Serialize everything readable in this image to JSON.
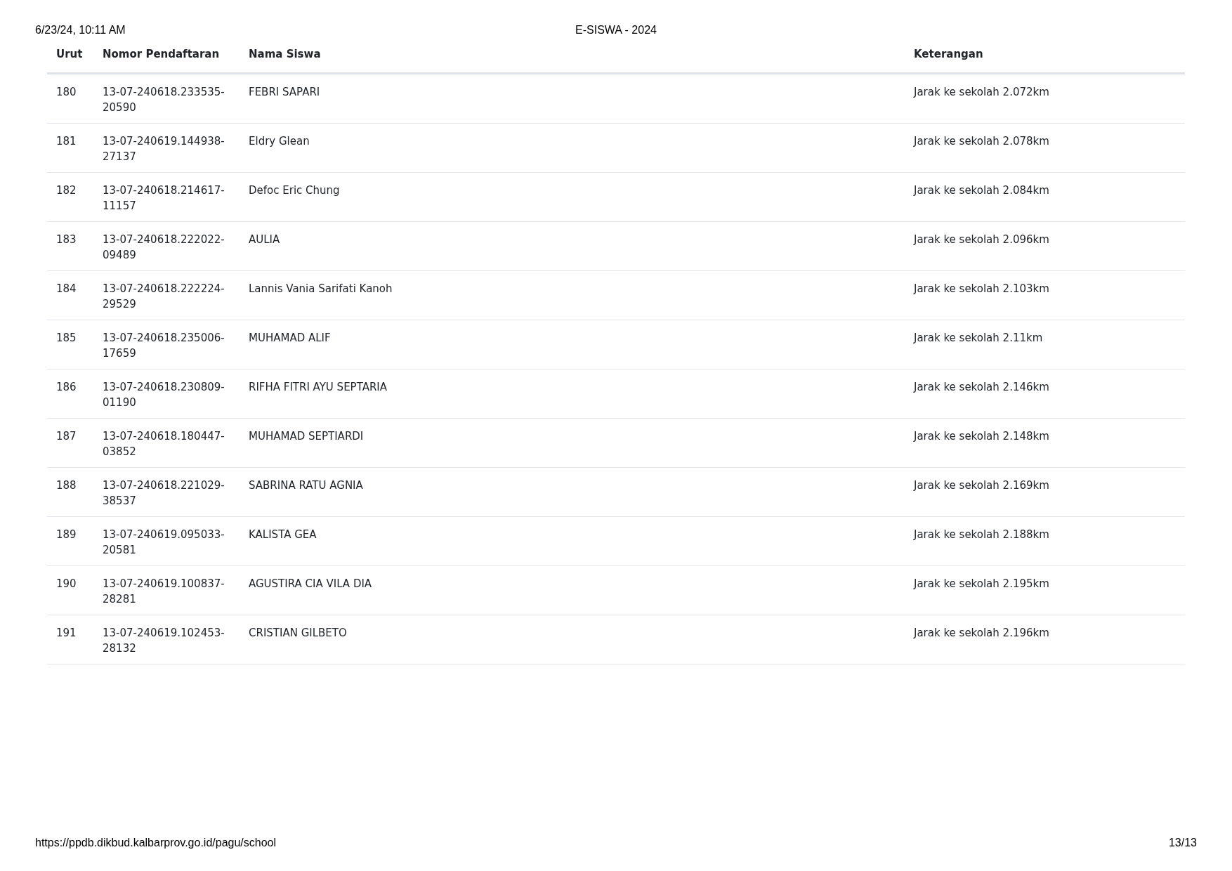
{
  "print_header": {
    "datetime": "6/23/24, 10:11 AM",
    "title": "E-SISWA - 2024"
  },
  "table": {
    "columns": [
      "Urut",
      "Nomor Pendaftaran",
      "Nama Siswa",
      "Keterangan"
    ],
    "rows": [
      {
        "urut": "180",
        "nomor": "13-07-240618.233535-20590",
        "nama": "FEBRI SAPARI",
        "keterangan": "Jarak ke sekolah 2.072km"
      },
      {
        "urut": "181",
        "nomor": "13-07-240619.144938-27137",
        "nama": "Eldry Glean",
        "keterangan": "Jarak ke sekolah 2.078km"
      },
      {
        "urut": "182",
        "nomor": "13-07-240618.214617-11157",
        "nama": "Defoc Eric Chung",
        "keterangan": "Jarak ke sekolah 2.084km"
      },
      {
        "urut": "183",
        "nomor": "13-07-240618.222022-09489",
        "nama": "AULIA",
        "keterangan": "Jarak ke sekolah 2.096km"
      },
      {
        "urut": "184",
        "nomor": "13-07-240618.222224-29529",
        "nama": "Lannis Vania Sarifati Kanoh",
        "keterangan": "Jarak ke sekolah 2.103km"
      },
      {
        "urut": "185",
        "nomor": "13-07-240618.235006-17659",
        "nama": "MUHAMAD ALIF",
        "keterangan": "Jarak ke sekolah 2.11km"
      },
      {
        "urut": "186",
        "nomor": "13-07-240618.230809-01190",
        "nama": "RIFHA FITRI AYU SEPTARIA",
        "keterangan": "Jarak ke sekolah 2.146km"
      },
      {
        "urut": "187",
        "nomor": "13-07-240618.180447-03852",
        "nama": "MUHAMAD SEPTIARDI",
        "keterangan": "Jarak ke sekolah 2.148km"
      },
      {
        "urut": "188",
        "nomor": "13-07-240618.221029-38537",
        "nama": "SABRINA RATU AGNIA",
        "keterangan": "Jarak ke sekolah 2.169km"
      },
      {
        "urut": "189",
        "nomor": "13-07-240619.095033-20581",
        "nama": "KALISTA GEA",
        "keterangan": "Jarak ke sekolah 2.188km"
      },
      {
        "urut": "190",
        "nomor": "13-07-240619.100837-28281",
        "nama": "AGUSTIRA CIA VILA DIA",
        "keterangan": "Jarak ke sekolah 2.195km"
      },
      {
        "urut": "191",
        "nomor": "13-07-240619.102453-28132",
        "nama": "CRISTIAN GILBETO",
        "keterangan": "Jarak ke sekolah 2.196km"
      }
    ]
  },
  "print_footer": {
    "url": "https://ppdb.dikbud.kalbarprov.go.id/pagu/school",
    "page": "13/13"
  }
}
